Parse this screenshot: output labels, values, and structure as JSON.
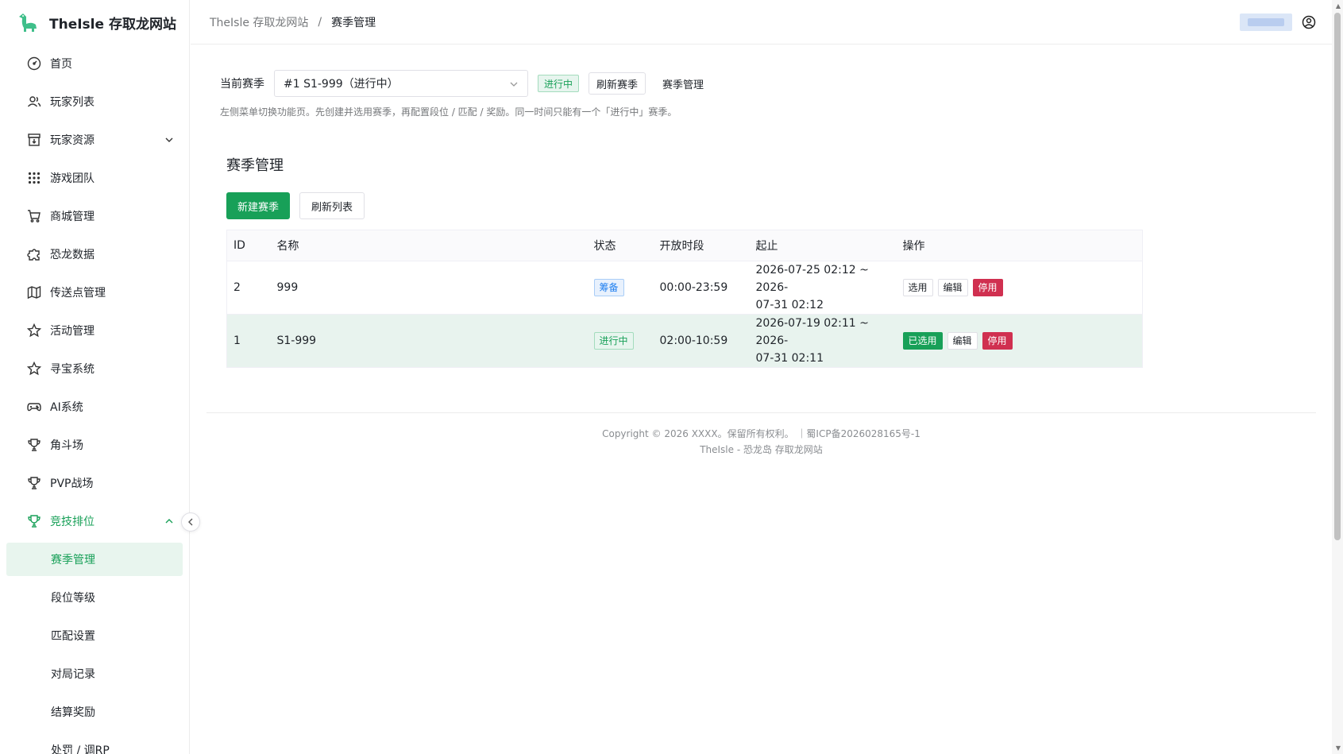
{
  "brand": {
    "title": "TheIsle 存取龙网站"
  },
  "header": {
    "breadcrumb": [
      "TheIsle 存取龙网站",
      "赛季管理"
    ],
    "separator": "/"
  },
  "sidebar": {
    "items": [
      {
        "label": "首页",
        "icon": "dashboard-icon"
      },
      {
        "label": "玩家列表",
        "icon": "users-icon"
      },
      {
        "label": "玩家资源",
        "icon": "archive-icon"
      },
      {
        "label": "游戏团队",
        "icon": "grid-icon"
      },
      {
        "label": "商城管理",
        "icon": "cart-icon"
      },
      {
        "label": "恐龙数据",
        "icon": "puzzle-icon"
      },
      {
        "label": "传送点管理",
        "icon": "map-icon"
      },
      {
        "label": "活动管理",
        "icon": "star-icon"
      },
      {
        "label": "寻宝系统",
        "icon": "star-icon"
      },
      {
        "label": "AI系统",
        "icon": "gamepad-icon"
      },
      {
        "label": "角斗场",
        "icon": "trophy-icon"
      },
      {
        "label": "PVP战场",
        "icon": "trophy-icon"
      },
      {
        "label": "竞技排位",
        "icon": "trophy-icon"
      }
    ],
    "subitems": [
      "赛季管理",
      "段位等级",
      "匹配设置",
      "对局记录",
      "结算奖励",
      "处罚 / 调RP"
    ]
  },
  "season_bar": {
    "label": "当前赛季",
    "selected": "#1 S1-999（进行中）",
    "status_tag": "进行中",
    "refresh_label": "刷新赛季",
    "manage_label": "赛季管理",
    "hint": "左侧菜单切换功能页。先创建并选用赛季，再配置段位 / 匹配 / 奖励。同一时间只能有一个「进行中」赛季。"
  },
  "section": {
    "title": "赛季管理",
    "new_button": "新建赛季",
    "refresh_button": "刷新列表"
  },
  "table": {
    "headers": [
      "ID",
      "名称",
      "状态",
      "开放时段",
      "起止",
      "操作"
    ],
    "rows": [
      {
        "id": "2",
        "name": "999",
        "status": "筹备",
        "hours": "00:00-23:59",
        "range1": "2026-07-25 02:12 ~ 2026-",
        "range2": "07-31 02:12",
        "op1": "选用",
        "op2": "编辑",
        "op3": "停用"
      },
      {
        "id": "1",
        "name": "S1-999",
        "status": "进行中",
        "hours": "02:00-10:59",
        "range1": "2026-07-19 02:11 ~ 2026-",
        "range2": "07-31 02:11",
        "op1": "已选用",
        "op2": "编辑",
        "op3": "停用"
      }
    ]
  },
  "footer": {
    "line1": "Copyright © 2026 XXXX。保留所有权利。 ｜蜀ICP备2026028165号-1",
    "line2": "TheIsle - 恐龙岛 存取龙网站"
  },
  "colors": {
    "accent": "#18a058",
    "danger": "#d03050",
    "info": "#2080f0"
  }
}
